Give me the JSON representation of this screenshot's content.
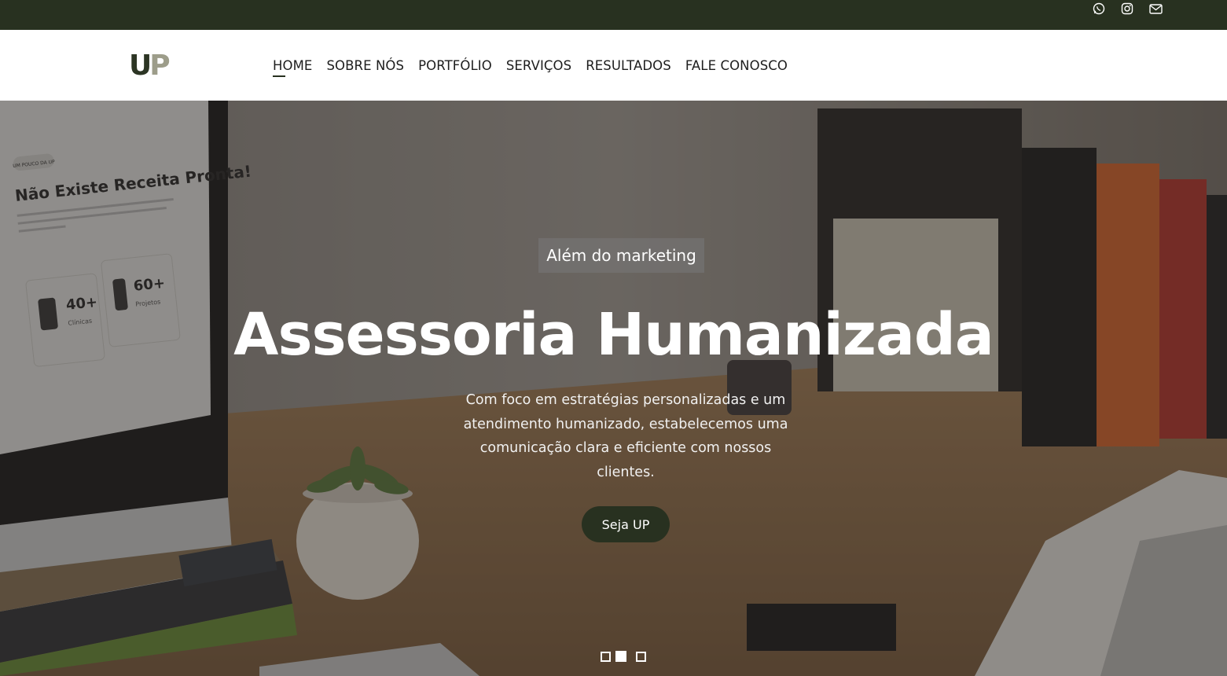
{
  "topbar": {
    "social_icons": [
      "whatsapp-icon",
      "instagram-icon",
      "mail-icon"
    ]
  },
  "header": {
    "logo": {
      "u": "U",
      "p": "P"
    },
    "nav": [
      {
        "label": "HOME",
        "active": true
      },
      {
        "label": "SOBRE NÓS"
      },
      {
        "label": "PORTFÓLIO"
      },
      {
        "label": "SERVIÇOS"
      },
      {
        "label": "RESULTADOS"
      },
      {
        "label": "FALE CONOSCO"
      }
    ]
  },
  "hero": {
    "badge": "Além do marketing",
    "title": "Assessoria Humanizada",
    "text": "Com foco em estratégias personalizadas e um atendimento humanizado, estabelecemos uma comunicação clara e eficiente com nossos clientes.",
    "cta": "Seja UP",
    "slider": {
      "count": 3,
      "active": 2
    },
    "screen": {
      "tag": "UM POUCO DA UP",
      "heading": "Não Existe Receita Pronta!",
      "stat1_value": "40+",
      "stat1_label": "Clínicas",
      "stat2_value": "60+",
      "stat2_label": "Projetos"
    }
  },
  "colors": {
    "brand_dark": "#283120",
    "logo_light": "#9d9d8a"
  }
}
